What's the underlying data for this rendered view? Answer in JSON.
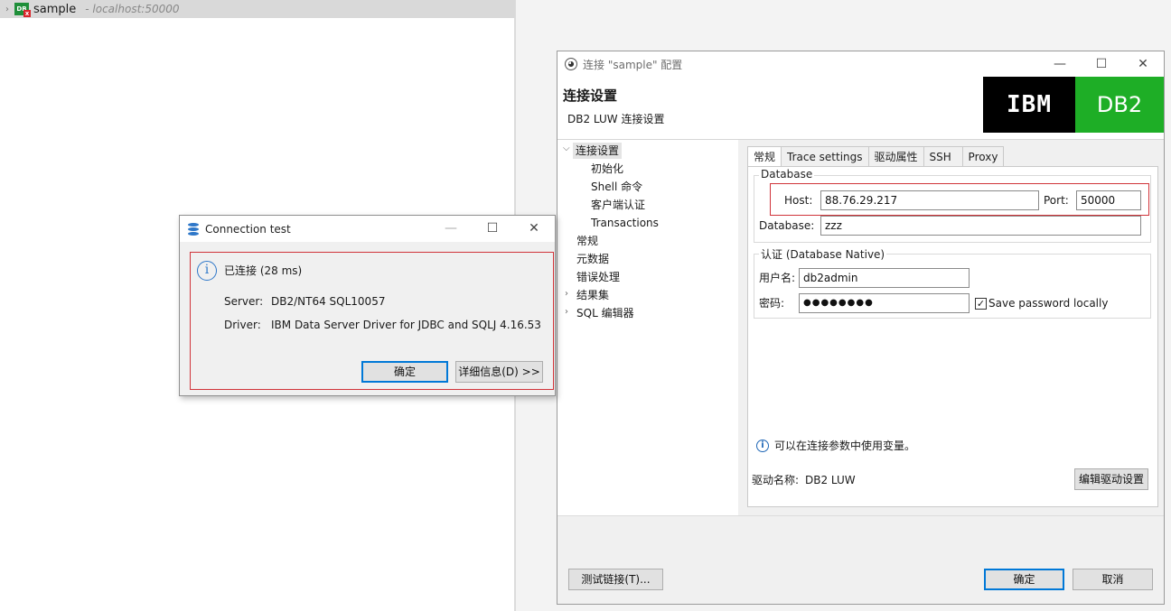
{
  "navigator": {
    "chevron": "›",
    "connection_icon": "db2-icon",
    "connection_name": "sample",
    "connection_host": "- localhost:50000"
  },
  "config_dialog": {
    "title": "连接 \"sample\" 配置",
    "window_buttons": [
      "—",
      "☐",
      "✕"
    ],
    "header_title": "连接设置",
    "header_subtitle": "DB2 LUW 连接设置",
    "brand_left": "IBM",
    "brand_right": "DB2",
    "brand_colors": {
      "ibm_bg": "#000000",
      "db2_bg": "#1eae26"
    },
    "tree": {
      "root": "连接设置",
      "children": [
        "初始化",
        "Shell 命令",
        "客户端认证",
        "Transactions"
      ],
      "items": [
        "常规",
        "元数据",
        "错误处理",
        "结果集",
        "SQL 编辑器"
      ]
    },
    "tabs": [
      "常规",
      "Trace settings",
      "驱动属性",
      "SSH",
      "Proxy"
    ],
    "database_group": {
      "title": "Database",
      "host_label": "Host:",
      "host_value": "88.76.29.217",
      "port_label": "Port:",
      "port_value": "50000",
      "database_label": "Database:",
      "database_value": "zzz"
    },
    "auth_group": {
      "title": "认证 (Database Native)",
      "user_label": "用户名:",
      "user_value": "db2admin",
      "password_label": "密码:",
      "password_value": "●●●●●●●●",
      "save_password_label": "Save password locally",
      "save_password_checked": true
    },
    "info_text": "可以在连接参数中使用变量。",
    "driver_label": "驱动名称:",
    "driver_value": "DB2 LUW",
    "edit_driver_button": "编辑驱动设置",
    "test_button": "测试链接(T)...",
    "ok_button": "确定",
    "cancel_button": "取消"
  },
  "connection_test": {
    "title": "Connection test",
    "window_buttons": [
      "—",
      "☐",
      "✕"
    ],
    "status": "已连接 (28 ms)",
    "server_label": "Server:",
    "server_value": "DB2/NT64 SQL10057",
    "driver_label": "Driver:",
    "driver_value": "IBM Data Server Driver for JDBC and SQLJ 4.16.53",
    "ok_button": "确定",
    "details_button": "详细信息(D) >>"
  }
}
